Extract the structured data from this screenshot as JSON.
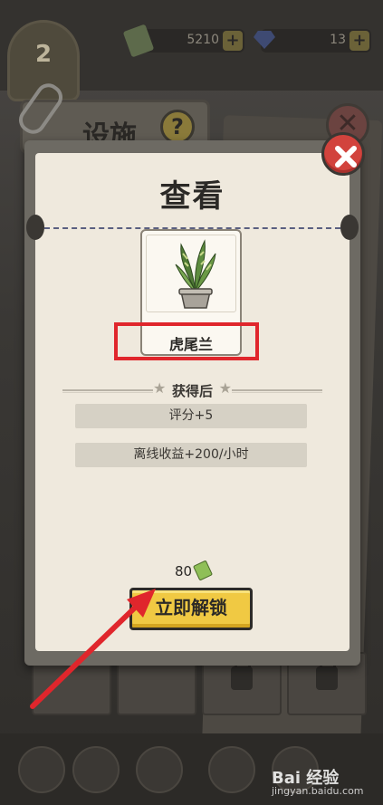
{
  "background": {
    "level": "2",
    "cash": "5210",
    "gems": "13",
    "facility_tab_title": "设施",
    "help_symbol": "?"
  },
  "modal": {
    "title": "查看",
    "item_name": "虎尾兰",
    "after_header": "获得后",
    "stats": [
      "评分+5",
      "离线收益+200/小时"
    ],
    "price": "80",
    "unlock_label": "立即解锁"
  },
  "watermark": {
    "brand": "Bai 经验",
    "site": "jingyan.baidu.com"
  },
  "colors": {
    "highlight_box": "#e0262c",
    "arrow": "#e0262c",
    "unlock_button": "#f0c943",
    "close_button": "#d2433d"
  },
  "icons": [
    "money-icon",
    "close-icon",
    "plant-icon",
    "help-icon",
    "lock-icon",
    "gem-icon",
    "cash-icon"
  ]
}
